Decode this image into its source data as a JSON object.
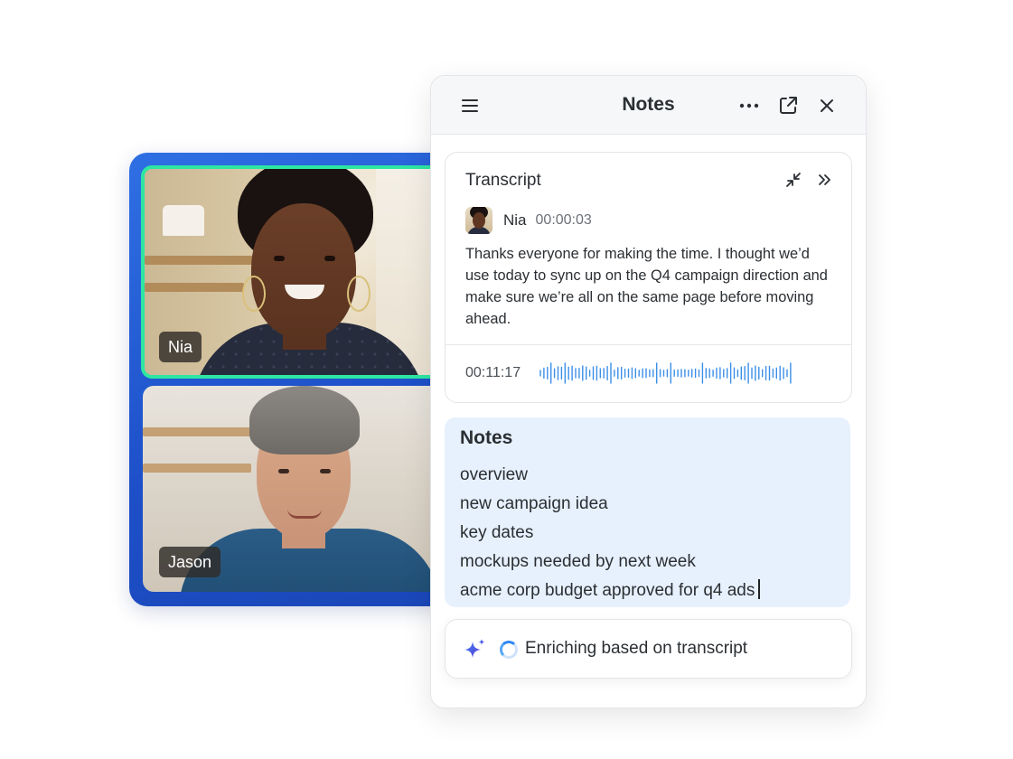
{
  "call": {
    "participants": [
      {
        "name": "Nia",
        "speaking": true
      },
      {
        "name": "Jason",
        "speaking": false
      }
    ],
    "colors": {
      "card": "#2f6fe4",
      "speaking_border": "#2ee6a3"
    }
  },
  "panel": {
    "title": "Notes",
    "icons": {
      "menu": "menu-icon",
      "more": "more-icon",
      "popout": "popout-icon",
      "close": "close-icon"
    }
  },
  "transcript": {
    "title": "Transcript",
    "icons": {
      "collapse": "collapse-icon",
      "expand": "double-chevron-right-icon"
    },
    "speaker": "Nia",
    "timestamp": "00:00:03",
    "text": "Thanks everyone for making the time. I thought we’d use today to sync up on the Q4 campaign direction and make sure we’re all on the same page before moving ahead.",
    "audio_time": "00:11:17",
    "waveform_color": "#3b8fe8"
  },
  "notes": {
    "title": "Notes",
    "items": [
      "overview",
      "new campaign idea",
      "key dates",
      "mockups needed by next week",
      "acme corp budget approved for q4 ads"
    ],
    "background": "#e7f1fd"
  },
  "enrich": {
    "text": "Enriching based on transcript",
    "icon": "sparkle-icon",
    "status_icon": "spinner-icon"
  }
}
